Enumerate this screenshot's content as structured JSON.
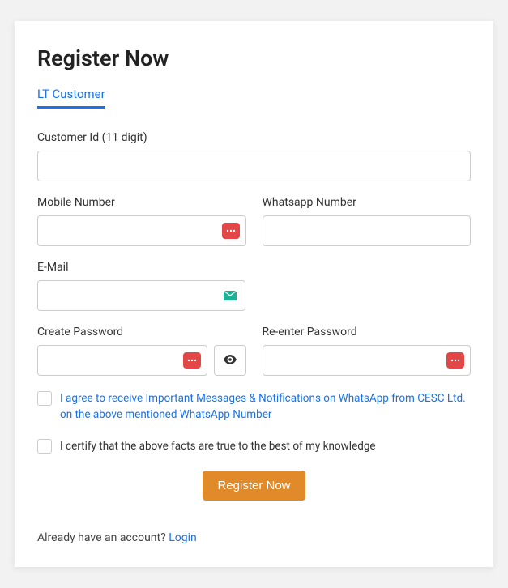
{
  "heading": "Register Now",
  "tab": {
    "label": "LT Customer"
  },
  "fields": {
    "customer_id": {
      "label": "Customer Id (11 digit)"
    },
    "mobile": {
      "label": "Mobile Number"
    },
    "whatsapp": {
      "label": "Whatsapp Number"
    },
    "email": {
      "label": "E-Mail"
    },
    "password": {
      "label": "Create Password"
    },
    "password2": {
      "label": "Re-enter Password"
    }
  },
  "checkboxes": {
    "whatsapp_consent": "I agree to receive Important Messages & Notifications on WhatsApp from CESC Ltd. on the above mentioned WhatsApp Number",
    "certify": "I certify that the above facts are true to the best of my knowledge"
  },
  "submit_label": "Register Now",
  "footer": {
    "prefix": "Already have an account? ",
    "link": "Login"
  }
}
